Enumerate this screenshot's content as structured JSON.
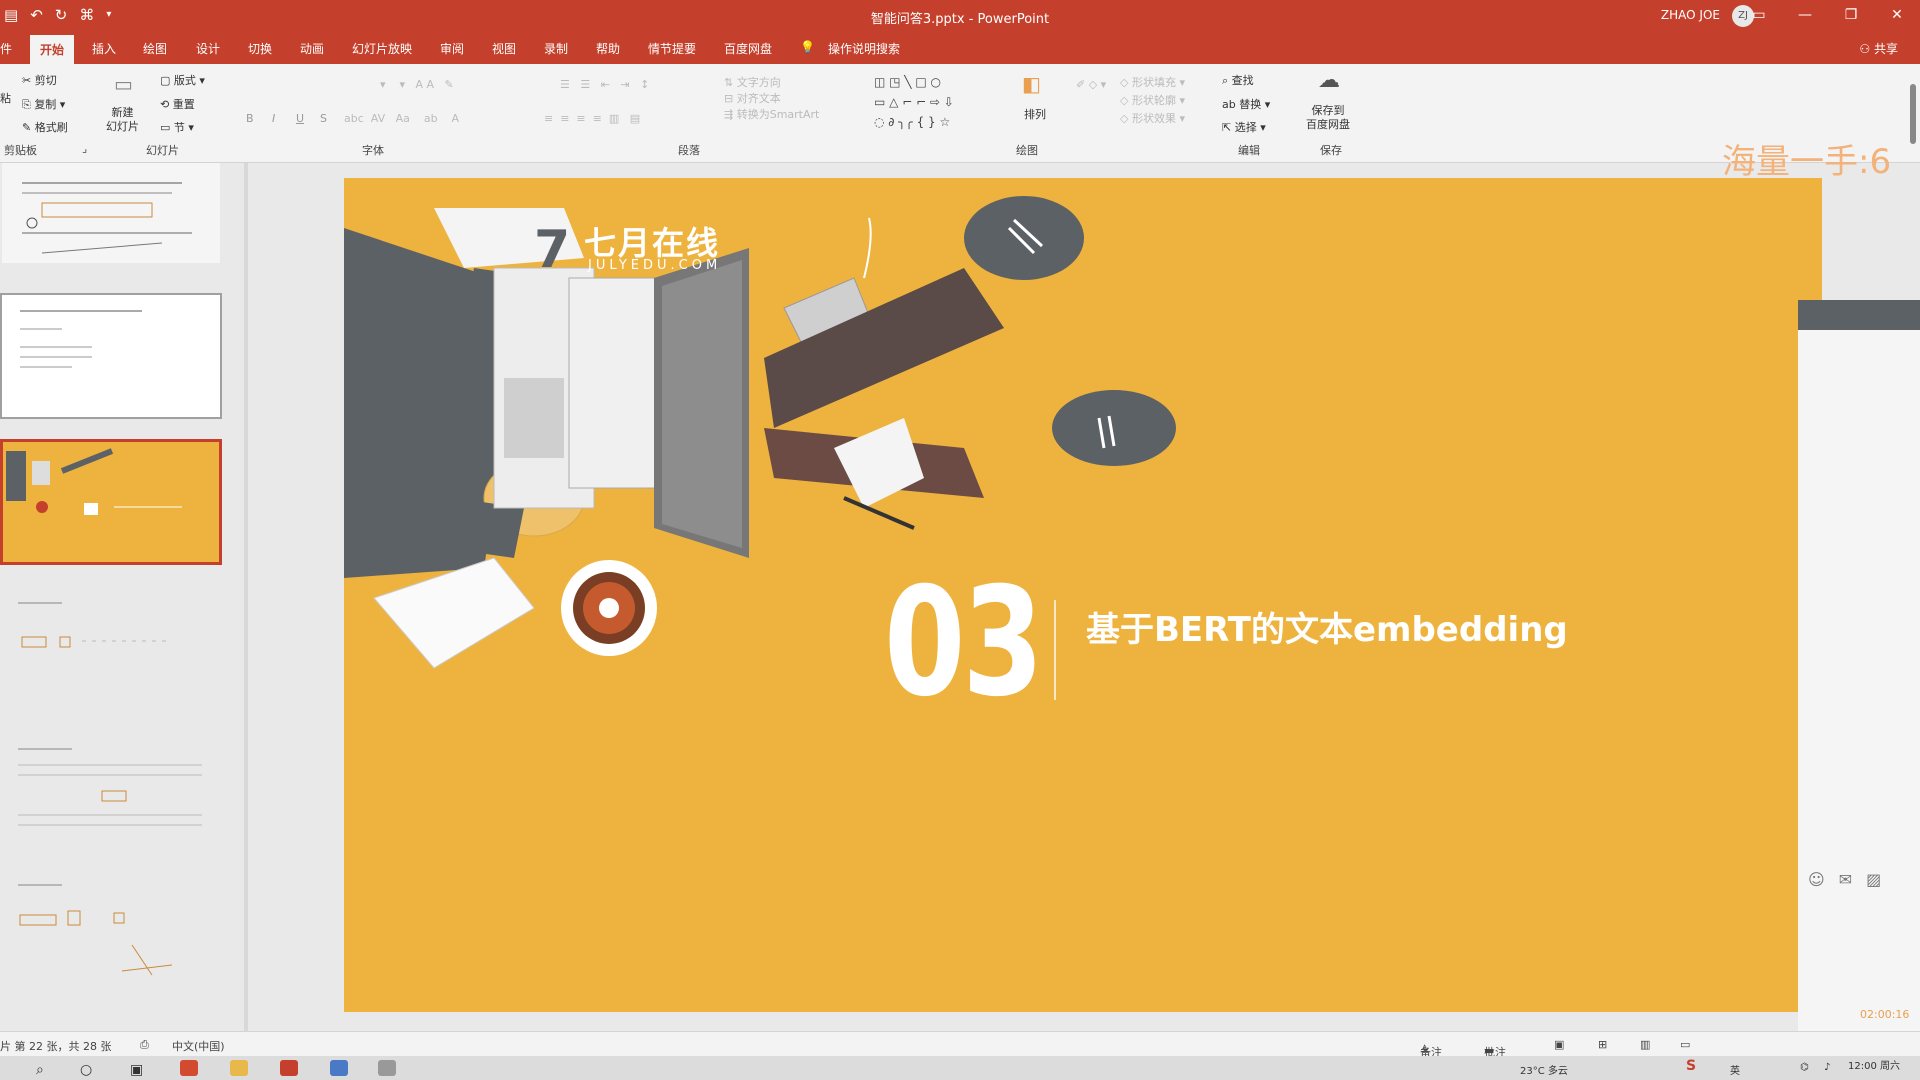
{
  "window": {
    "title": "智能问答3.pptx - PowerPoint",
    "user": "ZHAO JOE",
    "avatar_initials": "ZJ",
    "qat_icons": [
      "save-icon",
      "undo-icon",
      "redo-icon",
      "format-painter-icon",
      "customize-icon"
    ]
  },
  "tabs": [
    "开始",
    "插入",
    "绘图",
    "设计",
    "切换",
    "动画",
    "幻灯片放映",
    "审阅",
    "视图",
    "录制",
    "帮助",
    "情节提要",
    "百度网盘",
    "操作说明搜索"
  ],
  "tabs_partial_left": "件",
  "share": "共享",
  "ribbon": {
    "clipboard": {
      "cut": "剪切",
      "copy": "复制",
      "format_painter": "格式刷",
      "paste_partial": "粘",
      "group": "剪贴板"
    },
    "slides": {
      "new_slide": "新建\n幻灯片",
      "layout": "版式",
      "reset": "重置",
      "section": "节",
      "group": "幻灯片"
    },
    "font": {
      "group": "字体",
      "bold": "B",
      "italic": "I",
      "underline": "U",
      "shadow": "S"
    },
    "paragraph": {
      "group": "段落"
    },
    "drawing": {
      "arrange": "排列",
      "group": "绘图"
    },
    "editing": {
      "find": "查找",
      "replace": "替换",
      "select": "选择",
      "group": "编辑"
    },
    "save": {
      "save_to_baidu": "保存到\n百度网盘",
      "group": "保存"
    }
  },
  "slide": {
    "logo_cn": "七月在线",
    "logo_en": "JULYEDU.COM",
    "number": "03",
    "title": "基于BERT的文本embedding",
    "background_color": "#eeb33e"
  },
  "overlay": {
    "watermark_text": "海量一手:6",
    "timer": "02:00:16"
  },
  "statusbar": {
    "slide_info": "片 第 22 张，共 28 张",
    "language": "中文(中国)",
    "notes": "备注",
    "comments": "批注"
  },
  "taskbar": {
    "temperature": "23°C 多云",
    "time": "12:00 周六",
    "ime": "英"
  }
}
